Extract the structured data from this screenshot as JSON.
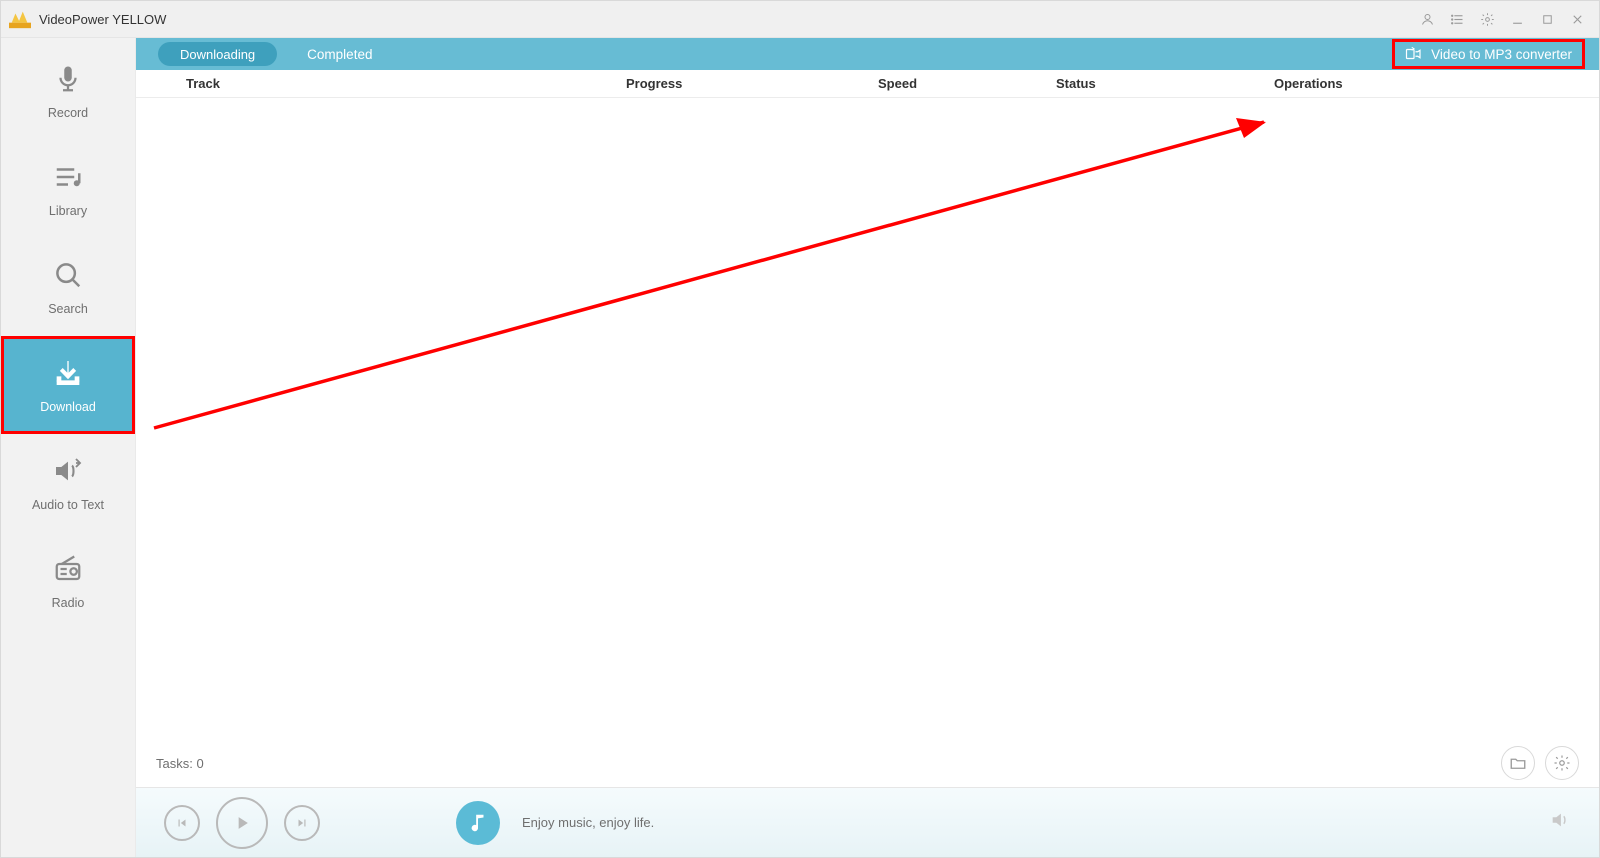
{
  "app": {
    "title": "VideoPower YELLOW"
  },
  "sidebar": {
    "items": [
      {
        "label": "Record"
      },
      {
        "label": "Library"
      },
      {
        "label": "Search"
      },
      {
        "label": "Download"
      },
      {
        "label": "Audio to Text"
      },
      {
        "label": "Radio"
      }
    ]
  },
  "topbar": {
    "tab_active": "Downloading",
    "tab_inactive": "Completed",
    "convert_label": "Video to MP3 converter"
  },
  "columns": {
    "track": "Track",
    "progress": "Progress",
    "speed": "Speed",
    "status": "Status",
    "operations": "Operations"
  },
  "footer": {
    "tasks_label": "Tasks: 0"
  },
  "player": {
    "slogan": "Enjoy music, enjoy life."
  }
}
